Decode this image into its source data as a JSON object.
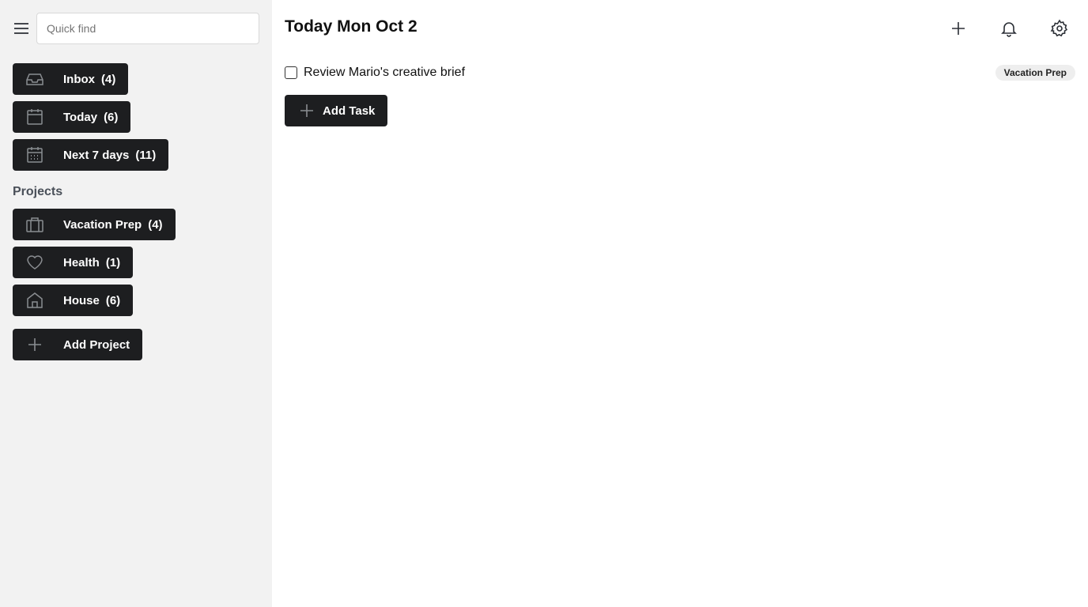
{
  "sidebar": {
    "menu_icon": "hamburger-menu-icon",
    "search": {
      "placeholder": "Quick find",
      "value": ""
    },
    "nav": [
      {
        "label": "Inbox",
        "count": "(4)",
        "icon": "inbox-icon"
      },
      {
        "label": "Today",
        "count": "(6)",
        "icon": "calendar-icon"
      },
      {
        "label": "Next 7 days",
        "count": "(11)",
        "icon": "calendar-week-icon"
      }
    ],
    "projects_heading": "Projects",
    "projects": [
      {
        "label": "Vacation Prep",
        "count": "(4)",
        "icon": "suitcase-icon"
      },
      {
        "label": "Health",
        "count": "(1)",
        "icon": "heart-icon"
      },
      {
        "label": "House",
        "count": "(6)",
        "icon": "house-icon"
      }
    ],
    "add_project_label": "Add Project"
  },
  "main": {
    "title_bold": "Today",
    "title_date": "Mon Oct 2",
    "header_icons": [
      "plus-icon",
      "bell-icon",
      "gear-icon"
    ],
    "tasks": [
      {
        "text": "Review Mario's creative brief",
        "project": "Vacation Prep",
        "checked": false
      }
    ],
    "add_task_label": "Add Task"
  },
  "colors": {
    "sidebar_bg": "#f2f2f2",
    "button_bg": "#1d1e20",
    "button_text": "#ffffff",
    "icon_gray": "#8a8d91",
    "badge_bg": "#eeeeee"
  }
}
